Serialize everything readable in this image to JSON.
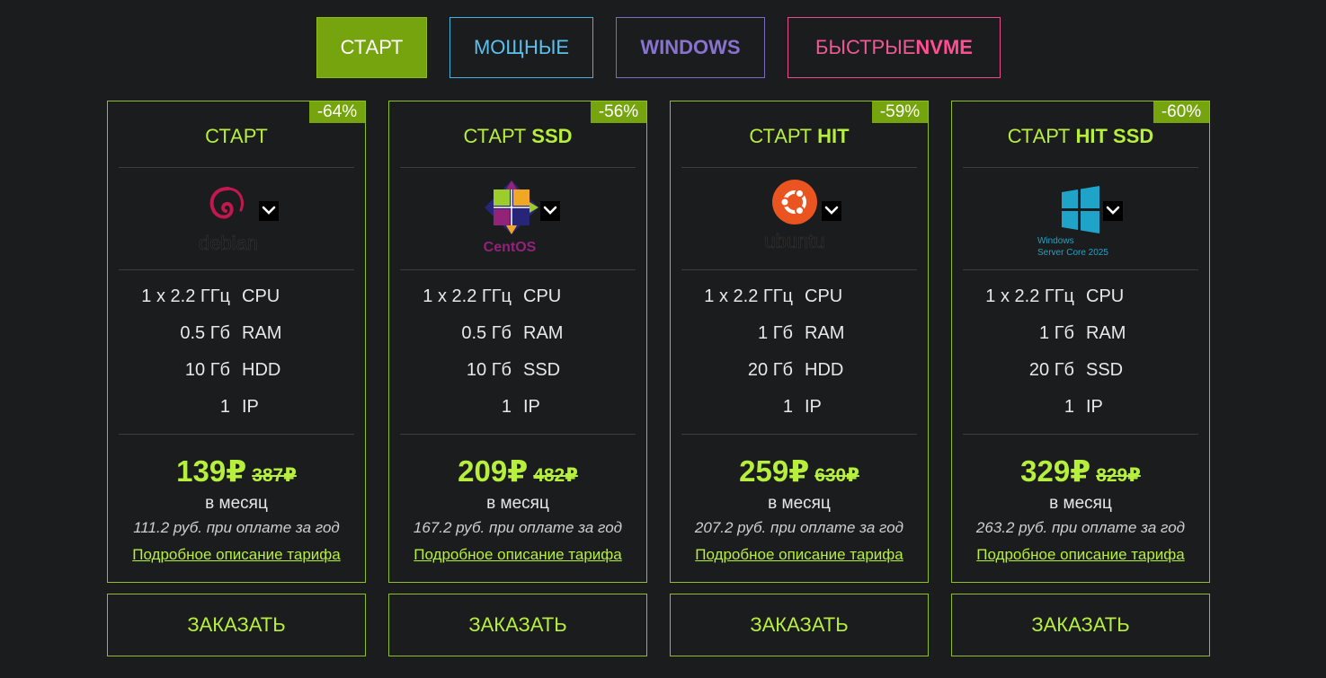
{
  "tabs": [
    {
      "label": "СТАРТ"
    },
    {
      "label": "МОЩНЫЕ"
    },
    {
      "label": "WINDOWS"
    },
    {
      "label_a": "БЫСТРЫЕ ",
      "label_b": "NVME"
    }
  ],
  "plans": [
    {
      "discount": "-64%",
      "title_a": "СТАРТ",
      "title_b": "",
      "os_icon": "debian-logo",
      "os_label": "debian",
      "specs": [
        {
          "value": "1 x 2.2 ГГц",
          "name": "CPU"
        },
        {
          "value": "0.5 Гб",
          "name": "RAM"
        },
        {
          "value": "10 Гб",
          "name": "HDD"
        },
        {
          "value": "1",
          "name": "IP"
        }
      ],
      "price": "139₽",
      "old_price": "387₽",
      "per_month": "в месяц",
      "yearly": "111.2 руб. при оплате за год",
      "details": "Подробное описание тарифа",
      "order": "ЗАКАЗАТЬ"
    },
    {
      "discount": "-56%",
      "title_a": "СТАРТ ",
      "title_b": "SSD",
      "os_icon": "centos-logo",
      "os_label": "CentOS",
      "specs": [
        {
          "value": "1 x 2.2 ГГц",
          "name": "CPU"
        },
        {
          "value": "0.5 Гб",
          "name": "RAM"
        },
        {
          "value": "10 Гб",
          "name": "SSD"
        },
        {
          "value": "1",
          "name": "IP"
        }
      ],
      "price": "209₽",
      "old_price": "482₽",
      "per_month": "в месяц",
      "yearly": "167.2 руб. при оплате за год",
      "details": "Подробное описание тарифа",
      "order": "ЗАКАЗАТЬ"
    },
    {
      "discount": "-59%",
      "title_a": "СТАРТ ",
      "title_b": "HIT",
      "os_icon": "ubuntu-logo",
      "os_label": "ubuntu",
      "specs": [
        {
          "value": "1 x 2.2 ГГц",
          "name": "CPU"
        },
        {
          "value": "1 Гб",
          "name": "RAM"
        },
        {
          "value": "20 Гб",
          "name": "HDD"
        },
        {
          "value": "1",
          "name": "IP"
        }
      ],
      "price": "259₽",
      "old_price": "630₽",
      "per_month": "в месяц",
      "yearly": "207.2 руб. при оплате за год",
      "details": "Подробное описание тарифа",
      "order": "ЗАКАЗАТЬ"
    },
    {
      "discount": "-60%",
      "title_a": "СТАРТ ",
      "title_b": "HIT SSD",
      "os_icon": "windows-logo",
      "os_label": "Windows",
      "os_label2": "Server Core 2025",
      "specs": [
        {
          "value": "1 x 2.2 ГГц",
          "name": "CPU"
        },
        {
          "value": "1 Гб",
          "name": "RAM"
        },
        {
          "value": "20 Гб",
          "name": "SSD"
        },
        {
          "value": "1",
          "name": "IP"
        }
      ],
      "price": "329₽",
      "old_price": "829₽",
      "per_month": "в месяц",
      "yearly": "263.2 руб. при оплате за год",
      "details": "Подробное описание тарифа",
      "order": "ЗАКАЗАТЬ"
    }
  ],
  "colors": {
    "accent": "#b7ef3d",
    "tab_active_bg": "#76a40f",
    "tab_power": "#5cc0ec",
    "tab_windows": "#8a72d0",
    "tab_nvme": "#ef5a94",
    "background": "#1b1c1e"
  }
}
